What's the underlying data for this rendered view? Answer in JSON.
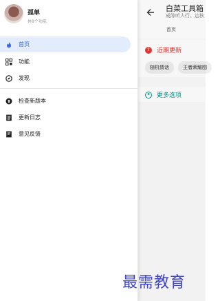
{
  "app": {
    "title": "白菜工具箱",
    "subtitle": "成隙听人行，边秋",
    "current_tab": "首页"
  },
  "sections": {
    "recent_updates": {
      "label": "近期更新",
      "chips": [
        "随机情话",
        "王者荣耀图"
      ]
    },
    "more_options": {
      "label": "更多选项"
    }
  },
  "drawer": {
    "user": {
      "name": "孤单",
      "description": "共8个功能"
    },
    "items": [
      {
        "label": "首页",
        "icon": "fire-icon",
        "active": true
      },
      {
        "label": "功能",
        "icon": "grid-icon"
      },
      {
        "label": "发现",
        "icon": "compass-icon"
      },
      {
        "label": "检查新版本",
        "icon": "upload-icon"
      },
      {
        "label": "更新日志",
        "icon": "document-icon"
      },
      {
        "label": "意见反馈",
        "icon": "feedback-icon"
      }
    ]
  },
  "watermark": "最需教育",
  "colors": {
    "accent_blue": "#3a66d6",
    "active_bg": "#e3ecfc",
    "red": "#e53935",
    "teal": "#009688"
  }
}
